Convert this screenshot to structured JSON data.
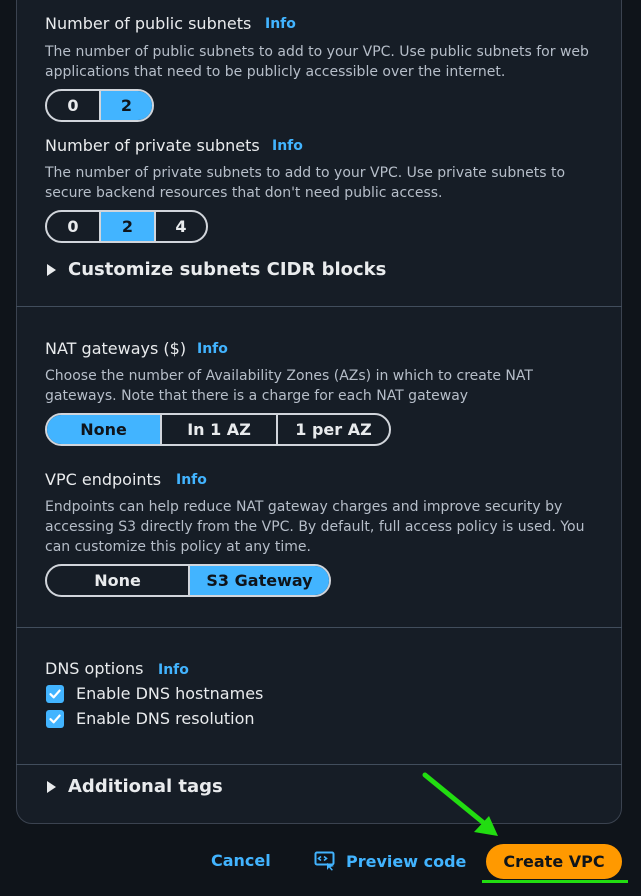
{
  "public_subnets": {
    "label": "Number of public subnets",
    "info": "Info",
    "description": "The number of public subnets to add to your VPC. Use public subnets for web applications that need to be publicly accessible over the internet.",
    "options": [
      "0",
      "2"
    ],
    "selected": "2"
  },
  "private_subnets": {
    "label": "Number of private subnets",
    "info": "Info",
    "description": "The number of private subnets to add to your VPC. Use private subnets to secure backend resources that don't need public access.",
    "options": [
      "0",
      "2",
      "4"
    ],
    "selected": "2"
  },
  "customize_cidr": {
    "label": "Customize subnets CIDR blocks"
  },
  "nat": {
    "label": "NAT gateways ($)",
    "info": "Info",
    "description": "Choose the number of Availability Zones (AZs) in which to create NAT gateways. Note that there is a charge for each NAT gateway",
    "options": [
      "None",
      "In 1 AZ",
      "1 per AZ"
    ],
    "selected": "None"
  },
  "endpoints": {
    "label": "VPC endpoints",
    "info": "Info",
    "description": "Endpoints can help reduce NAT gateway charges and improve security by accessing S3 directly from the VPC. By default, full access policy is used. You can customize this policy at any time.",
    "options": [
      "None",
      "S3 Gateway"
    ],
    "selected": "S3 Gateway"
  },
  "dns": {
    "label": "DNS options",
    "info": "Info",
    "hostnames": {
      "label": "Enable DNS hostnames",
      "checked": true
    },
    "resolution": {
      "label": "Enable DNS resolution",
      "checked": true
    }
  },
  "additional_tags": {
    "label": "Additional tags"
  },
  "footer": {
    "cancel": "Cancel",
    "preview": "Preview code",
    "create": "Create VPC"
  },
  "colors": {
    "accent": "#42b4ff",
    "primary": "#ff9900",
    "annotation": "#22dd11"
  }
}
